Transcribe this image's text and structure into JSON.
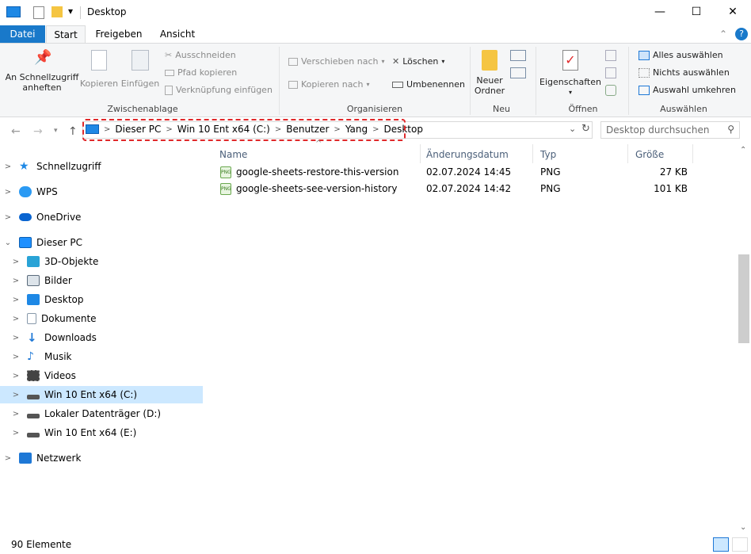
{
  "window": {
    "title": "Desktop"
  },
  "titlebar": {
    "qat_dropdown": "▾",
    "minimize": "—",
    "maximize": "☐",
    "close": "✕"
  },
  "menu": {
    "tabs": [
      "Datei",
      "Start",
      "Freigeben",
      "Ansicht"
    ],
    "active_tab": "Start",
    "collapse": "⌃",
    "help": "?"
  },
  "ribbon": {
    "clipboard": {
      "label": "Zwischenablage",
      "pin_line1": "An Schnellzugriff",
      "pin_line2": "anheften",
      "copy": "Kopieren",
      "paste": "Einfügen",
      "cut": "Ausschneiden",
      "copy_path": "Pfad kopieren",
      "paste_shortcut": "Verknüpfung einfügen"
    },
    "organize": {
      "label": "Organisieren",
      "move_to": "Verschieben nach",
      "copy_to": "Kopieren nach",
      "delete": "Löschen",
      "rename": "Umbenennen"
    },
    "new": {
      "label": "Neu",
      "new_folder_line1": "Neuer",
      "new_folder_line2": "Ordner"
    },
    "open": {
      "label": "Öffnen",
      "properties": "Eigenschaften"
    },
    "select": {
      "label": "Auswählen",
      "select_all": "Alles auswählen",
      "select_none": "Nichts auswählen",
      "invert": "Auswahl umkehren"
    }
  },
  "address": {
    "crumbs": [
      "Dieser PC",
      "Win 10 Ent x64 (C:)",
      "Benutzer",
      "Yang",
      "Desktop"
    ],
    "search_placeholder": "Desktop durchsuchen"
  },
  "nav": {
    "items": [
      {
        "label": "Schnellzugriff",
        "icon": "star-icon",
        "color": "#1e88e5"
      },
      {
        "label": "WPS",
        "icon": "cloud-icon",
        "color": "#2b9af3"
      },
      {
        "label": "OneDrive",
        "icon": "cloud-icon",
        "color": "#0a64d0"
      },
      {
        "label": "Dieser PC",
        "icon": "computer-icon",
        "color": "#1e90ff"
      },
      {
        "label": "3D-Objekte",
        "icon": "cube-icon",
        "color": "#29a3d6"
      },
      {
        "label": "Bilder",
        "icon": "pictures-icon",
        "color": "#5b6b7b"
      },
      {
        "label": "Desktop",
        "icon": "desktop-icon",
        "color": "#1e88e5"
      },
      {
        "label": "Dokumente",
        "icon": "document-icon",
        "color": "#8899aa"
      },
      {
        "label": "Downloads",
        "icon": "download-icon",
        "color": "#1e78d6"
      },
      {
        "label": "Musik",
        "icon": "music-icon",
        "color": "#1e78d6"
      },
      {
        "label": "Videos",
        "icon": "video-icon",
        "color": "#444444"
      },
      {
        "label": "Win 10 Ent x64 (C:)",
        "icon": "drive-icon",
        "color": "#555555"
      },
      {
        "label": "Lokaler Datenträger (D:)",
        "icon": "drive-icon",
        "color": "#555555"
      },
      {
        "label": "Win 10 Ent x64 (E:)",
        "icon": "drive-icon",
        "color": "#555555"
      },
      {
        "label": "Netzwerk",
        "icon": "network-icon",
        "color": "#1e78d6"
      }
    ],
    "selected": "Win 10 Ent x64 (C:)"
  },
  "files": {
    "columns": [
      "Name",
      "Änderungsdatum",
      "Typ",
      "Größe"
    ],
    "sort_indicator": "^",
    "rows": [
      {
        "name": "google-sheets-restore-this-version",
        "date": "02.07.2024 14:45",
        "type": "PNG",
        "size": "27 KB"
      },
      {
        "name": "google-sheets-see-version-history",
        "date": "02.07.2024 14:42",
        "type": "PNG",
        "size": "101 KB"
      }
    ]
  },
  "status": {
    "count": "90 Elemente"
  },
  "colors": {
    "accent": "#1979ca",
    "highlight": "#e0282a",
    "selection": "#cce8ff"
  }
}
